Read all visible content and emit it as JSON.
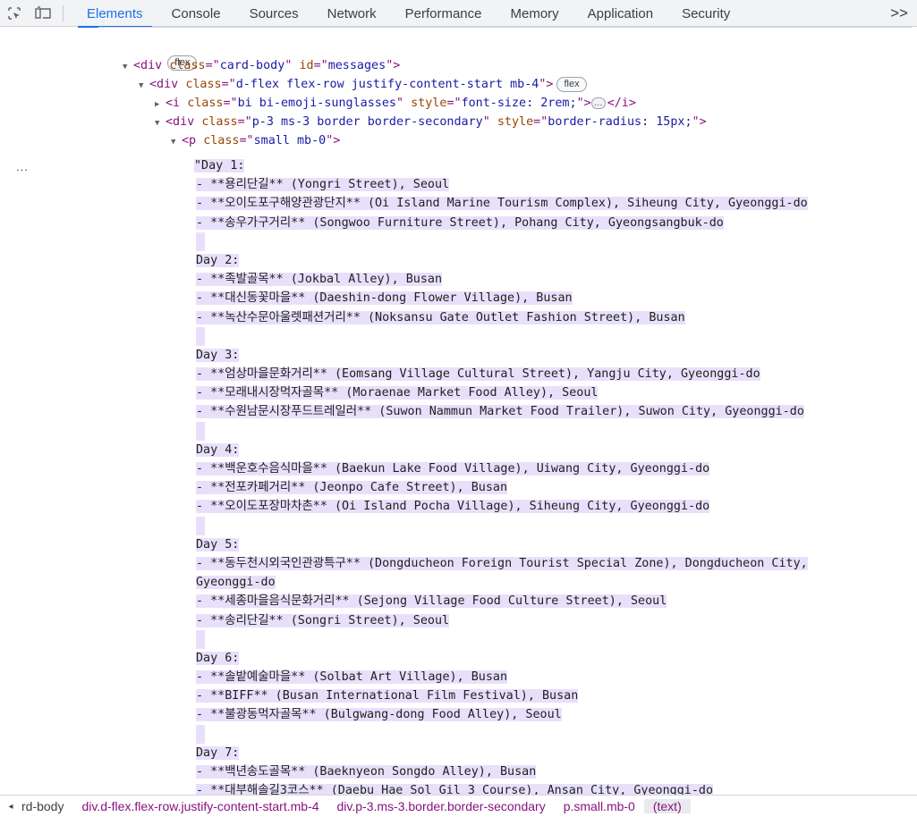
{
  "toolbar": {
    "tabs": [
      "Elements",
      "Console",
      "Sources",
      "Network",
      "Performance",
      "Memory",
      "Application",
      "Security"
    ],
    "active_tab": "Elements",
    "more_label": ">>"
  },
  "tree": {
    "top_badge": "flex",
    "lines": [
      {
        "open": "<div",
        "attrs": [
          [
            "class",
            "card-body"
          ],
          [
            "id",
            "messages"
          ]
        ],
        "close": ">"
      },
      {
        "open": "<div",
        "attrs": [
          [
            "class",
            "d-flex flex-row justify-content-start mb-4"
          ]
        ],
        "close": ">",
        "badge": "flex"
      },
      {
        "open": "<i",
        "attrs": [
          [
            "class",
            "bi bi-emoji-sunglasses"
          ],
          [
            "style",
            "font-size: 2rem;"
          ]
        ],
        "close": ">",
        "ellipsis": "…",
        "end": "</i>"
      },
      {
        "open": "<div",
        "attrs": [
          [
            "class",
            "p-3 ms-3 border border-secondary"
          ],
          [
            "style",
            "border-radius: 15px;"
          ]
        ],
        "close": ">"
      },
      {
        "open": "<p",
        "attrs": [
          [
            "class",
            "small mb-0"
          ]
        ],
        "close": ">"
      }
    ],
    "text_lines": [
      "\"Day 1:",
      "- **용리단길** (Yongri Street), Seoul",
      "- **오이도포구해양관광단지** (Oi Island Marine Tourism Complex), Siheung City, Gyeonggi-do",
      "- **송우가구거리** (Songwoo Furniture Street), Pohang City, Gyeongsangbuk-do",
      "",
      "Day 2:",
      "- **족발골목** (Jokbal Alley), Busan",
      "- **대신동꽃마을** (Daeshin-dong Flower Village), Busan",
      "- **녹산수문아울렛패션거리** (Noksansu Gate Outlet Fashion Street), Busan",
      "",
      "Day 3:",
      "- **엄상마을문화거리** (Eomsang Village Cultural Street), Yangju City, Gyeonggi-do",
      "- **모래내시장먹자골목** (Moraenae Market Food Alley), Seoul",
      "- **수원남문시장푸드트레일러** (Suwon Nammun Market Food Trailer), Suwon City, Gyeonggi-do",
      "",
      "Day 4:",
      "- **백운호수음식마을** (Baekun Lake Food Village), Uiwang City, Gyeonggi-do",
      "- **전포카페거리** (Jeonpo Cafe Street), Busan",
      "- **오이도포장마차촌** (Oi Island Pocha Village), Siheung City, Gyeonggi-do",
      "",
      "Day 5:",
      "- **동두천시외국인관광특구** (Dongducheon Foreign Tourist Special Zone), Dongducheon City,",
      "Gyeonggi-do",
      "- **세종마을음식문화거리** (Sejong Village Food Culture Street), Seoul",
      "- **송리단길** (Songri Street), Seoul",
      "",
      "Day 6:",
      "- **솔밭예술마을** (Solbat Art Village), Busan",
      "- **BIFF** (Busan International Film Festival), Busan",
      "- **불광동먹자골목** (Bulgwang-dong Food Alley), Seoul",
      "",
      "Day 7:",
      "- **백년송도골목** (Baeknyeon Songdo Alley), Busan",
      "- **대부해솔길3코스** (Daebu Hae Sol Gil 3 Course), Ansan City, Gyeonggi-do"
    ],
    "gutter_dots": "..."
  },
  "breadcrumb": {
    "arrow": "◂",
    "items": [
      "rd-body",
      "div.d-flex.flex-row.justify-content-start.mb-4",
      "div.p-3.ms-3.border.border-secondary",
      "p.small.mb-0",
      "(text)"
    ]
  },
  "colors": {
    "tag": "#881280",
    "attr": "#994500",
    "value": "#1a1aa6",
    "active_tab": "#1a73e8",
    "text_highlight": "#e8e0fb"
  }
}
